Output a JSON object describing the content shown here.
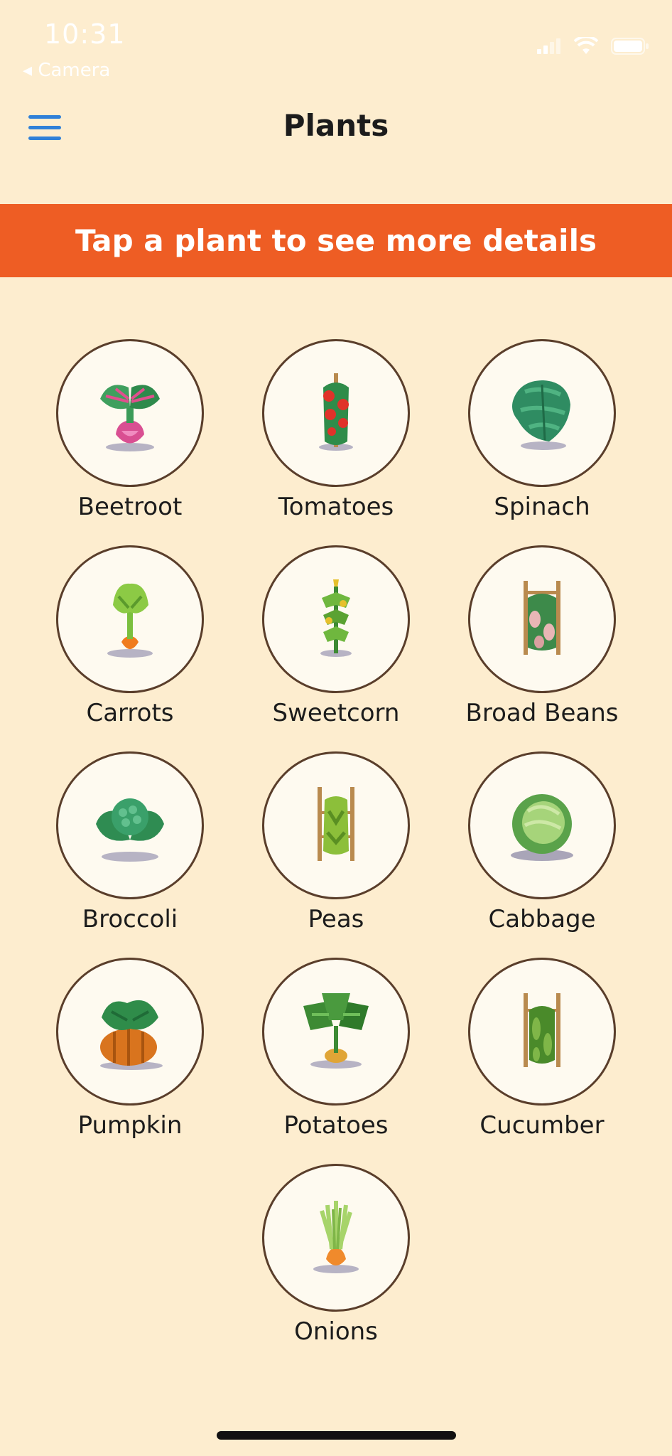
{
  "status_bar": {
    "time": "10:31",
    "back_app": "◂ Camera"
  },
  "nav": {
    "title": "Plants",
    "menu_icon": "hamburger-icon"
  },
  "banner": {
    "text": "Tap a plant to see more details",
    "color": "#ee5d24"
  },
  "colors": {
    "background": "#fdedcf",
    "accent": "#2f80d8",
    "circle_border": "#5a3e2b"
  },
  "plants": [
    {
      "name": "Beetroot",
      "icon": "beetroot-icon"
    },
    {
      "name": "Tomatoes",
      "icon": "tomato-plant-icon"
    },
    {
      "name": "Spinach",
      "icon": "spinach-icon"
    },
    {
      "name": "Carrots",
      "icon": "carrot-icon"
    },
    {
      "name": "Sweetcorn",
      "icon": "sweetcorn-icon"
    },
    {
      "name": "Broad Beans",
      "icon": "broad-beans-icon"
    },
    {
      "name": "Broccoli",
      "icon": "broccoli-icon"
    },
    {
      "name": "Peas",
      "icon": "peas-icon"
    },
    {
      "name": "Cabbage",
      "icon": "cabbage-icon"
    },
    {
      "name": "Pumpkin",
      "icon": "pumpkin-icon"
    },
    {
      "name": "Potatoes",
      "icon": "potato-plant-icon"
    },
    {
      "name": "Cucumber",
      "icon": "cucumber-icon"
    },
    {
      "name": "Onions",
      "icon": "onion-icon"
    }
  ]
}
